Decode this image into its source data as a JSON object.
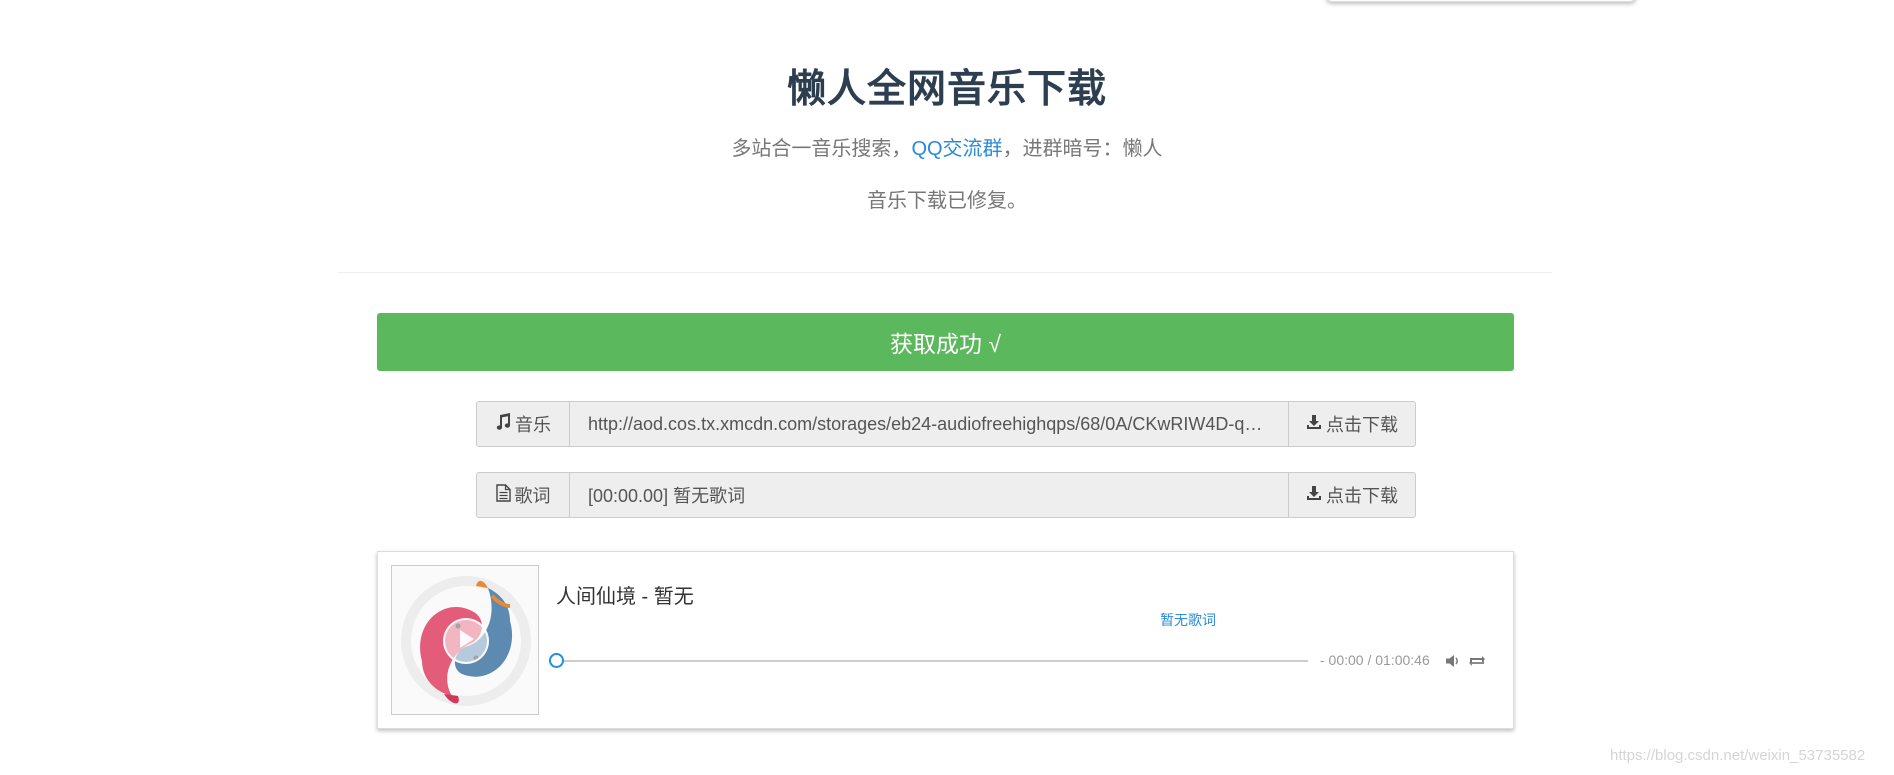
{
  "header": {
    "title": "懒人全网音乐下载",
    "subtitle_prefix": "多站合一音乐搜索，",
    "qq_group_link": "QQ交流群",
    "subtitle_suffix": "，进群暗号：懒人",
    "notice": "音乐下载已修复。"
  },
  "status": {
    "message": "获取成功 √",
    "color": "#5cb85c"
  },
  "music_row": {
    "icon": "music-note-icon",
    "label": "音乐",
    "url": "http://aod.cos.tx.xmcdn.com/storages/eb24-audiofreehighqps/68/0A/CKwRIW4D-qAB...",
    "download_icon": "download-icon",
    "download_label": "点击下载"
  },
  "lyric_row": {
    "icon": "file-text-icon",
    "label": "歌词",
    "value": "[00:00.00] 暂无歌词",
    "download_icon": "download-icon",
    "download_label": "点击下载"
  },
  "player": {
    "song": "人间仙境 - 暂无",
    "lyric": "暂无歌词",
    "time": "- 00:00 / 01:00:46",
    "progress": 0,
    "accent_color": "#2a8bd8"
  },
  "watermark": "https://blog.csdn.net/weixin_53735582"
}
